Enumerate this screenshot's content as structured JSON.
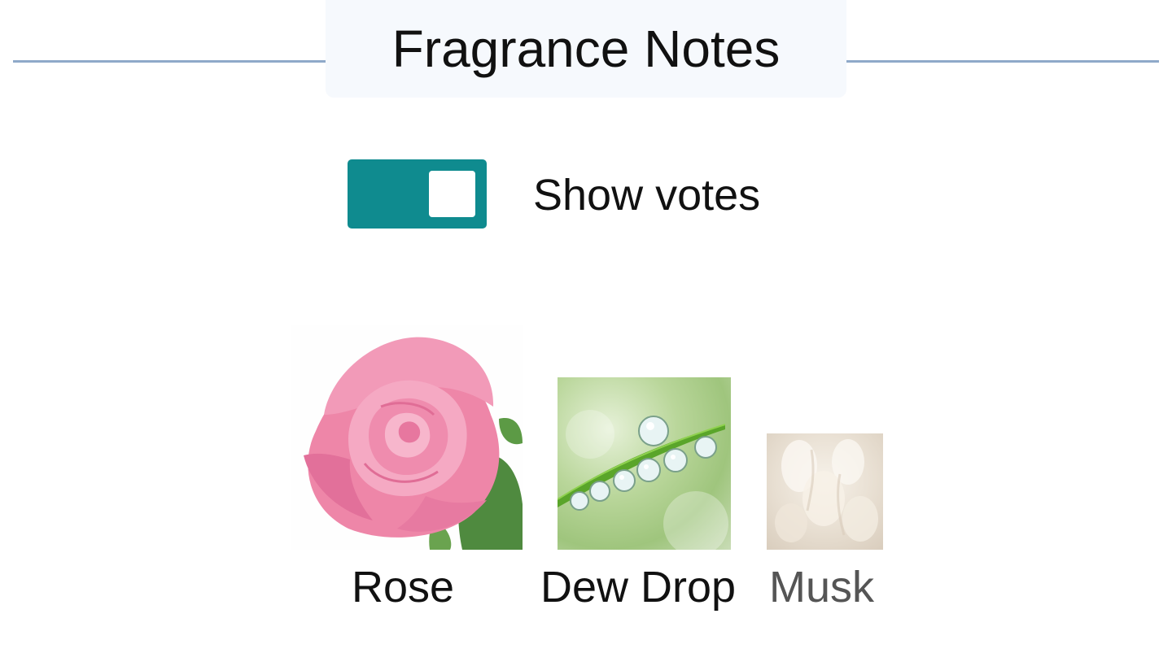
{
  "header": {
    "title": "Fragrance Notes"
  },
  "toggle": {
    "label": "Show votes",
    "checked": true,
    "color": "#0f8b8f"
  },
  "notes": [
    {
      "name": "Rose",
      "image": "rose-image",
      "label_color": "#111111"
    },
    {
      "name": "Dew Drop",
      "image": "dew-drop-image",
      "label_color": "#111111"
    },
    {
      "name": "Musk",
      "image": "musk-image",
      "label_color": "#555555"
    }
  ],
  "colors": {
    "accent": "#0f8b8f",
    "rule": "#8fa9c9",
    "title_background": "#f6f9fd"
  }
}
